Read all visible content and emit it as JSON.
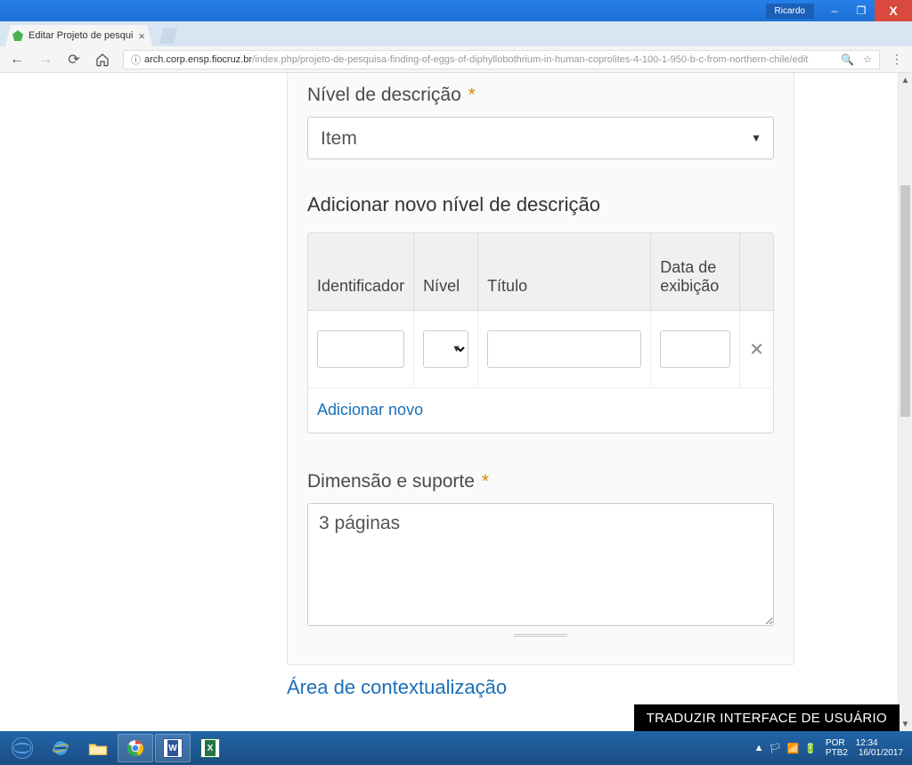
{
  "window": {
    "user_label": "Ricardo",
    "min_glyph": "–",
    "max_glyph": "❐",
    "close_glyph": "X"
  },
  "browser": {
    "tab_title": "Editar Projeto de pesqui",
    "tab_close": "×",
    "url_host": "arch.corp.ensp.fiocruz.br",
    "url_path": "/index.php/projeto-de-pesquisa-finding-of-eggs-of-diphyllobothrium-in-human-coprolites-4-100-1-950-b-c-from-northern-chile/edit",
    "info_glyph": "ⓘ",
    "back": "←",
    "forward": "→",
    "reload": "⟳",
    "zoom_glyph": "🔍",
    "star_glyph": "☆",
    "menu_glyph": "⋮"
  },
  "form": {
    "level_label": "Nível de descrição",
    "level_value": "Item",
    "add_section_title": "Adicionar novo nível de descrição",
    "cols": {
      "id": "Identificador",
      "nivel": "Nível",
      "titulo": "Título",
      "data": "Data de exibição"
    },
    "row": {
      "id": "",
      "nivel": "",
      "titulo": "",
      "data": "",
      "del": "✕"
    },
    "add_new": "Adicionar novo",
    "extent_label": "Dimensão e suporte",
    "extent_value": "3 páginas",
    "required_mark": "*",
    "next_section": "Área de contextualização"
  },
  "translate_banner": "TRADUZIR INTERFACE DE USUÁRIO",
  "taskbar": {
    "tray_up": "▲",
    "tray_flag": "🏳",
    "tray_net": "📶",
    "tray_battery": "🔋",
    "lang1": "POR",
    "lang2": "PTB2",
    "time": "12:34",
    "date": "16/01/2017"
  }
}
